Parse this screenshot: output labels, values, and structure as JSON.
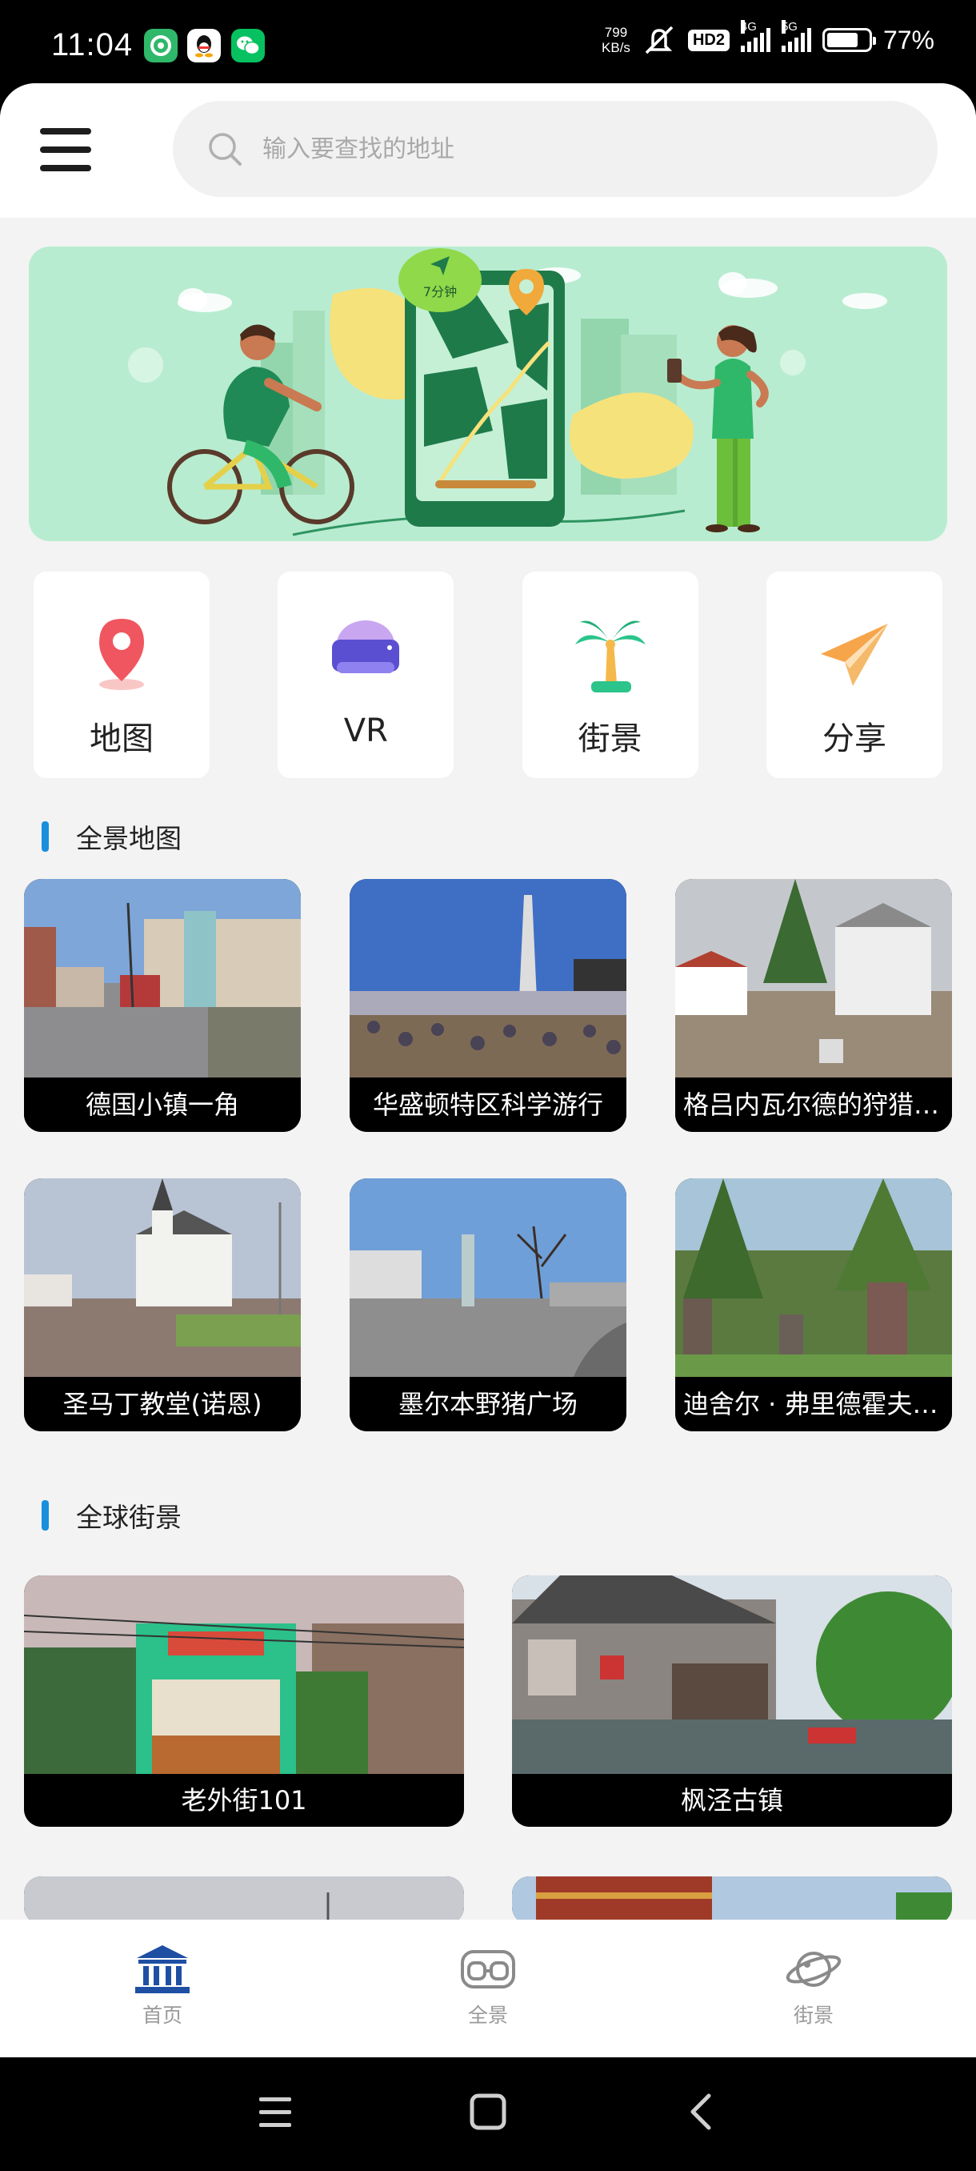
{
  "status_bar": {
    "time": "11:04",
    "net_speed_value": "799",
    "net_speed_unit": "KB/s",
    "hd_badge": "HD2",
    "signal_1_label": "4G",
    "signal_2_label": "5G",
    "battery_level": 0.77,
    "battery_text": "77%"
  },
  "header": {
    "search_placeholder": "输入要查找的地址"
  },
  "banner": {
    "badge_text": "7分钟"
  },
  "quick_actions": [
    {
      "label": "地图",
      "icon": "map-pin-icon"
    },
    {
      "label": "VR",
      "icon": "vr-headset-icon"
    },
    {
      "label": "街景",
      "icon": "palm-tree-icon"
    },
    {
      "label": "分享",
      "icon": "paper-plane-icon"
    }
  ],
  "sections": {
    "panorama_title": "全景地图",
    "street_title": "全球街景"
  },
  "panorama_items": [
    {
      "caption": "德国小镇一角"
    },
    {
      "caption": "华盛顿特区科学游行"
    },
    {
      "caption": "格吕内瓦尔德的狩猎小屋"
    },
    {
      "caption": "圣马丁教堂(诺恩)"
    },
    {
      "caption": "墨尔本野猪广场"
    },
    {
      "caption": "迪舍尔 · 弗里德霍夫公墓"
    }
  ],
  "street_items": [
    {
      "caption": "老外街101"
    },
    {
      "caption": "枫泾古镇"
    }
  ],
  "tabbar": {
    "tabs": [
      {
        "label": "首页",
        "icon": "bank-icon"
      },
      {
        "label": "全景",
        "icon": "vr-glasses-icon"
      },
      {
        "label": "街景",
        "icon": "planet-icon"
      }
    ]
  },
  "colors": {
    "accent": "#1a8fdc",
    "banner_bg": "#b8ecd0",
    "active_tab": "#1e4fa3"
  }
}
